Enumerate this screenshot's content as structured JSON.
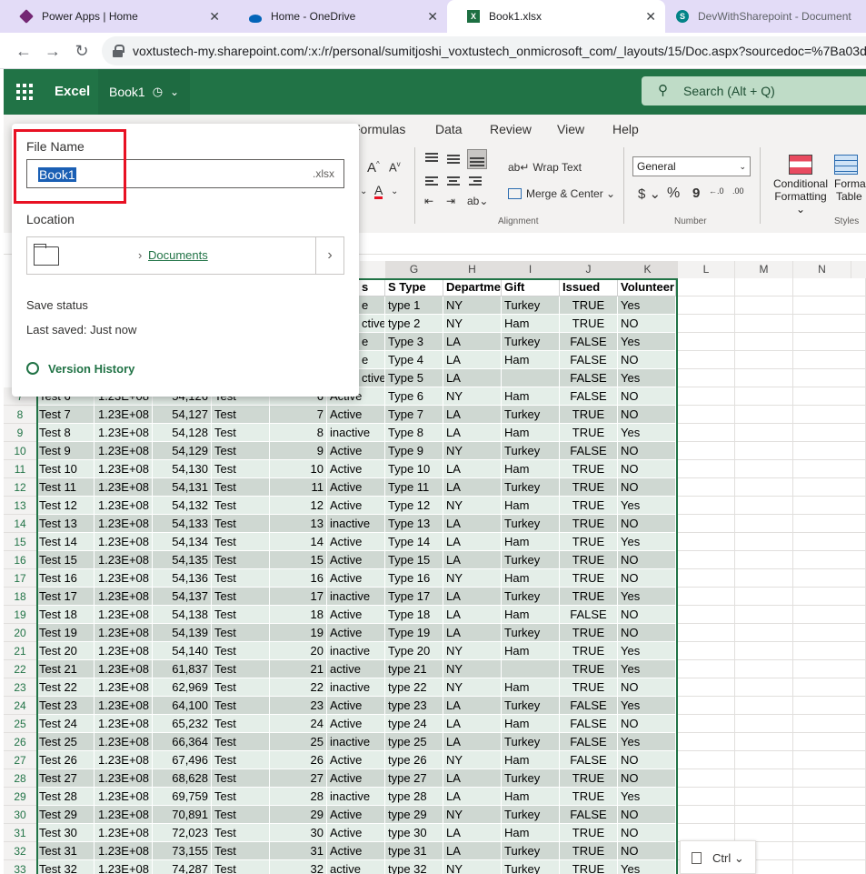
{
  "browser": {
    "tabs": [
      {
        "title": "Power Apps | Home",
        "icon": "power-apps-icon"
      },
      {
        "title": "Home - OneDrive",
        "icon": "onedrive-icon"
      },
      {
        "title": "Book1.xlsx",
        "icon": "excel-icon",
        "active": true
      },
      {
        "title": "DevWithSharepoint - Document",
        "icon": "sharepoint-icon"
      }
    ],
    "url": "voxtustech-my.sharepoint.com/:x:/r/personal/sumitjoshi_voxtustech_onmicrosoft_com/_layouts/15/Doc.aspx?sourcedoc=%7Ba03dc"
  },
  "excel": {
    "app_name": "Excel",
    "doc_name": "Book1",
    "search_placeholder": "Search (Alt + Q)",
    "accent": "#217346"
  },
  "ribbon": {
    "tabs": [
      "Formulas",
      "Data",
      "Review",
      "View",
      "Help"
    ],
    "wrap_text": "Wrap Text",
    "merge_center": "Merge & Center",
    "alignment_label": "Alignment",
    "number_format": "General",
    "number_label": "Number",
    "conditional_formatting_1": "Conditional",
    "conditional_formatting_2": "Formatting",
    "format_table_1": "Forma",
    "format_table_2": "Table",
    "styles_label": "Styles",
    "font_grow": "A",
    "font_shrink": "A",
    "currency": "$",
    "percent": "%",
    "comma": "9"
  },
  "flyout": {
    "file_name_label": "File Name",
    "file_name_value": "Book1",
    "file_ext": ".xlsx",
    "location_label": "Location",
    "location_link": "Documents",
    "save_status_label": "Save status",
    "last_saved": "Last saved: Just now",
    "version_history": "Version History"
  },
  "grid": {
    "columns": [
      "G",
      "H",
      "I",
      "J",
      "K",
      "L",
      "M",
      "N"
    ],
    "headers": {
      "f": "s",
      "g": "S Type",
      "h": "Departme",
      "i": "Gift",
      "j": "Issued",
      "k": "Volunteer"
    },
    "top_rows": [
      {
        "f": "e",
        "g": "type 1",
        "h": "NY",
        "i": "Turkey",
        "j": "TRUE",
        "k": "Yes"
      },
      {
        "f": "ctive",
        "g": "type 2",
        "h": "NY",
        "i": "Ham",
        "j": "TRUE",
        "k": "NO"
      },
      {
        "f": "e",
        "g": "Type 3",
        "h": "LA",
        "i": "Turkey",
        "j": "FALSE",
        "k": "Yes"
      },
      {
        "f": "e",
        "g": "Type 4",
        "h": "LA",
        "i": "Ham",
        "j": "FALSE",
        "k": "NO"
      },
      {
        "f": "ctive",
        "g": "Type 5",
        "h": "LA",
        "i": "",
        "j": "FALSE",
        "k": "Yes"
      }
    ],
    "rows": [
      {
        "n": "7",
        "a": "Test 6",
        "b": "1.23E+08",
        "c": "54,126",
        "d": "Test",
        "e": "6",
        "f": "Active",
        "g": "Type 6",
        "h": "NY",
        "i": "Ham",
        "j": "FALSE",
        "k": "NO"
      },
      {
        "n": "8",
        "a": "Test 7",
        "b": "1.23E+08",
        "c": "54,127",
        "d": "Test",
        "e": "7",
        "f": "Active",
        "g": "Type 7",
        "h": "LA",
        "i": "Turkey",
        "j": "TRUE",
        "k": "NO"
      },
      {
        "n": "9",
        "a": "Test 8",
        "b": "1.23E+08",
        "c": "54,128",
        "d": "Test",
        "e": "8",
        "f": "inactive",
        "g": "Type 8",
        "h": "LA",
        "i": "Ham",
        "j": "TRUE",
        "k": "Yes"
      },
      {
        "n": "10",
        "a": "Test 9",
        "b": "1.23E+08",
        "c": "54,129",
        "d": "Test",
        "e": "9",
        "f": "Active",
        "g": "Type 9",
        "h": "NY",
        "i": "Turkey",
        "j": "FALSE",
        "k": "NO"
      },
      {
        "n": "11",
        "a": "Test 10",
        "b": "1.23E+08",
        "c": "54,130",
        "d": "Test",
        "e": "10",
        "f": "Active",
        "g": "Type 10",
        "h": "LA",
        "i": "Ham",
        "j": "TRUE",
        "k": "NO"
      },
      {
        "n": "12",
        "a": "Test 11",
        "b": "1.23E+08",
        "c": "54,131",
        "d": "Test",
        "e": "11",
        "f": "Active",
        "g": "Type 11",
        "h": "LA",
        "i": "Turkey",
        "j": "TRUE",
        "k": "NO"
      },
      {
        "n": "13",
        "a": "Test 12",
        "b": "1.23E+08",
        "c": "54,132",
        "d": "Test",
        "e": "12",
        "f": "Active",
        "g": "Type 12",
        "h": "NY",
        "i": "Ham",
        "j": "TRUE",
        "k": "Yes"
      },
      {
        "n": "14",
        "a": "Test 13",
        "b": "1.23E+08",
        "c": "54,133",
        "d": "Test",
        "e": "13",
        "f": "inactive",
        "g": "Type 13",
        "h": "LA",
        "i": "Turkey",
        "j": "TRUE",
        "k": "NO"
      },
      {
        "n": "15",
        "a": "Test 14",
        "b": "1.23E+08",
        "c": "54,134",
        "d": "Test",
        "e": "14",
        "f": "Active",
        "g": "Type 14",
        "h": "LA",
        "i": "Ham",
        "j": "TRUE",
        "k": "Yes"
      },
      {
        "n": "16",
        "a": "Test 15",
        "b": "1.23E+08",
        "c": "54,135",
        "d": "Test",
        "e": "15",
        "f": "Active",
        "g": "Type 15",
        "h": "LA",
        "i": "Turkey",
        "j": "TRUE",
        "k": "NO"
      },
      {
        "n": "17",
        "a": "Test 16",
        "b": "1.23E+08",
        "c": "54,136",
        "d": "Test",
        "e": "16",
        "f": "Active",
        "g": "Type 16",
        "h": "NY",
        "i": "Ham",
        "j": "TRUE",
        "k": "NO"
      },
      {
        "n": "18",
        "a": "Test 17",
        "b": "1.23E+08",
        "c": "54,137",
        "d": "Test",
        "e": "17",
        "f": "inactive",
        "g": "Type 17",
        "h": "LA",
        "i": "Turkey",
        "j": "TRUE",
        "k": "Yes"
      },
      {
        "n": "19",
        "a": "Test 18",
        "b": "1.23E+08",
        "c": "54,138",
        "d": "Test",
        "e": "18",
        "f": "Active",
        "g": "Type 18",
        "h": "LA",
        "i": "Ham",
        "j": "FALSE",
        "k": "NO"
      },
      {
        "n": "20",
        "a": "Test 19",
        "b": "1.23E+08",
        "c": "54,139",
        "d": "Test",
        "e": "19",
        "f": "Active",
        "g": "Type 19",
        "h": "LA",
        "i": "Turkey",
        "j": "TRUE",
        "k": "NO"
      },
      {
        "n": "21",
        "a": "Test 20",
        "b": "1.23E+08",
        "c": "54,140",
        "d": "Test",
        "e": "20",
        "f": "inactive",
        "g": "Type 20",
        "h": "NY",
        "i": "Ham",
        "j": "TRUE",
        "k": "Yes"
      },
      {
        "n": "22",
        "a": "Test 21",
        "b": "1.23E+08",
        "c": "61,837",
        "d": "Test",
        "e": "21",
        "f": "active",
        "g": "type 21",
        "h": "NY",
        "i": "",
        "j": "TRUE",
        "k": "Yes"
      },
      {
        "n": "23",
        "a": "Test 22",
        "b": "1.23E+08",
        "c": "62,969",
        "d": "Test",
        "e": "22",
        "f": "inactive",
        "g": "type 22",
        "h": "NY",
        "i": "Ham",
        "j": "TRUE",
        "k": "NO"
      },
      {
        "n": "24",
        "a": "Test 23",
        "b": "1.23E+08",
        "c": "64,100",
        "d": "Test",
        "e": "23",
        "f": "Active",
        "g": "type 23",
        "h": "LA",
        "i": "Turkey",
        "j": "FALSE",
        "k": "Yes"
      },
      {
        "n": "25",
        "a": "Test 24",
        "b": "1.23E+08",
        "c": "65,232",
        "d": "Test",
        "e": "24",
        "f": "Active",
        "g": "type 24",
        "h": "LA",
        "i": "Ham",
        "j": "FALSE",
        "k": "NO"
      },
      {
        "n": "26",
        "a": "Test 25",
        "b": "1.23E+08",
        "c": "66,364",
        "d": "Test",
        "e": "25",
        "f": "inactive",
        "g": "type 25",
        "h": "LA",
        "i": "Turkey",
        "j": "FALSE",
        "k": "Yes"
      },
      {
        "n": "27",
        "a": "Test 26",
        "b": "1.23E+08",
        "c": "67,496",
        "d": "Test",
        "e": "26",
        "f": "Active",
        "g": "type 26",
        "h": "NY",
        "i": "Ham",
        "j": "FALSE",
        "k": "NO"
      },
      {
        "n": "28",
        "a": "Test 27",
        "b": "1.23E+08",
        "c": "68,628",
        "d": "Test",
        "e": "27",
        "f": "Active",
        "g": "type 27",
        "h": "LA",
        "i": "Turkey",
        "j": "TRUE",
        "k": "NO"
      },
      {
        "n": "29",
        "a": "Test 28",
        "b": "1.23E+08",
        "c": "69,759",
        "d": "Test",
        "e": "28",
        "f": "inactive",
        "g": "type 28",
        "h": "LA",
        "i": "Ham",
        "j": "TRUE",
        "k": "Yes"
      },
      {
        "n": "30",
        "a": "Test 29",
        "b": "1.23E+08",
        "c": "70,891",
        "d": "Test",
        "e": "29",
        "f": "Active",
        "g": "type 29",
        "h": "NY",
        "i": "Turkey",
        "j": "FALSE",
        "k": "NO"
      },
      {
        "n": "31",
        "a": "Test 30",
        "b": "1.23E+08",
        "c": "72,023",
        "d": "Test",
        "e": "30",
        "f": "Active",
        "g": "type 30",
        "h": "LA",
        "i": "Ham",
        "j": "TRUE",
        "k": "NO"
      },
      {
        "n": "32",
        "a": "Test 31",
        "b": "1.23E+08",
        "c": "73,155",
        "d": "Test",
        "e": "31",
        "f": "Active",
        "g": "type 31",
        "h": "LA",
        "i": "Turkey",
        "j": "TRUE",
        "k": "NO"
      },
      {
        "n": "33",
        "a": "Test 32",
        "b": "1.23E+08",
        "c": "74,287",
        "d": "Test",
        "e": "32",
        "f": "active",
        "g": "type 32",
        "h": "NY",
        "i": "Turkey",
        "j": "TRUE",
        "k": "Yes"
      }
    ]
  },
  "paste_options": {
    "label": "Ctrl",
    "icon": "paste-icon"
  }
}
